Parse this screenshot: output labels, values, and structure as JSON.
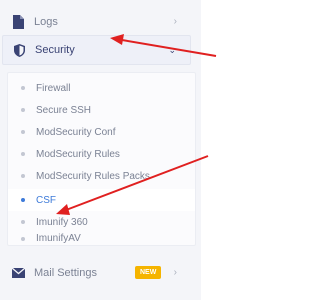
{
  "sidebar": {
    "logs": {
      "label": "Logs",
      "icon": "file-icon"
    },
    "security": {
      "label": "Security",
      "icon": "shield-icon"
    },
    "security_submenu": [
      {
        "label": "Firewall"
      },
      {
        "label": "Secure SSH"
      },
      {
        "label": "ModSecurity Conf"
      },
      {
        "label": "ModSecurity Rules"
      },
      {
        "label": "ModSecurity Rules Packs"
      },
      {
        "label": "CSF",
        "active": true
      },
      {
        "label": "Imunify 360"
      },
      {
        "label": "ImunifyAV"
      }
    ],
    "mail": {
      "label": "Mail Settings",
      "badge": "NEW",
      "icon": "envelope-icon"
    }
  },
  "colors": {
    "accent": "#3e7bd9",
    "arrow": "#e02020",
    "badge": "#f5b400",
    "security_text": "#3a4374"
  }
}
